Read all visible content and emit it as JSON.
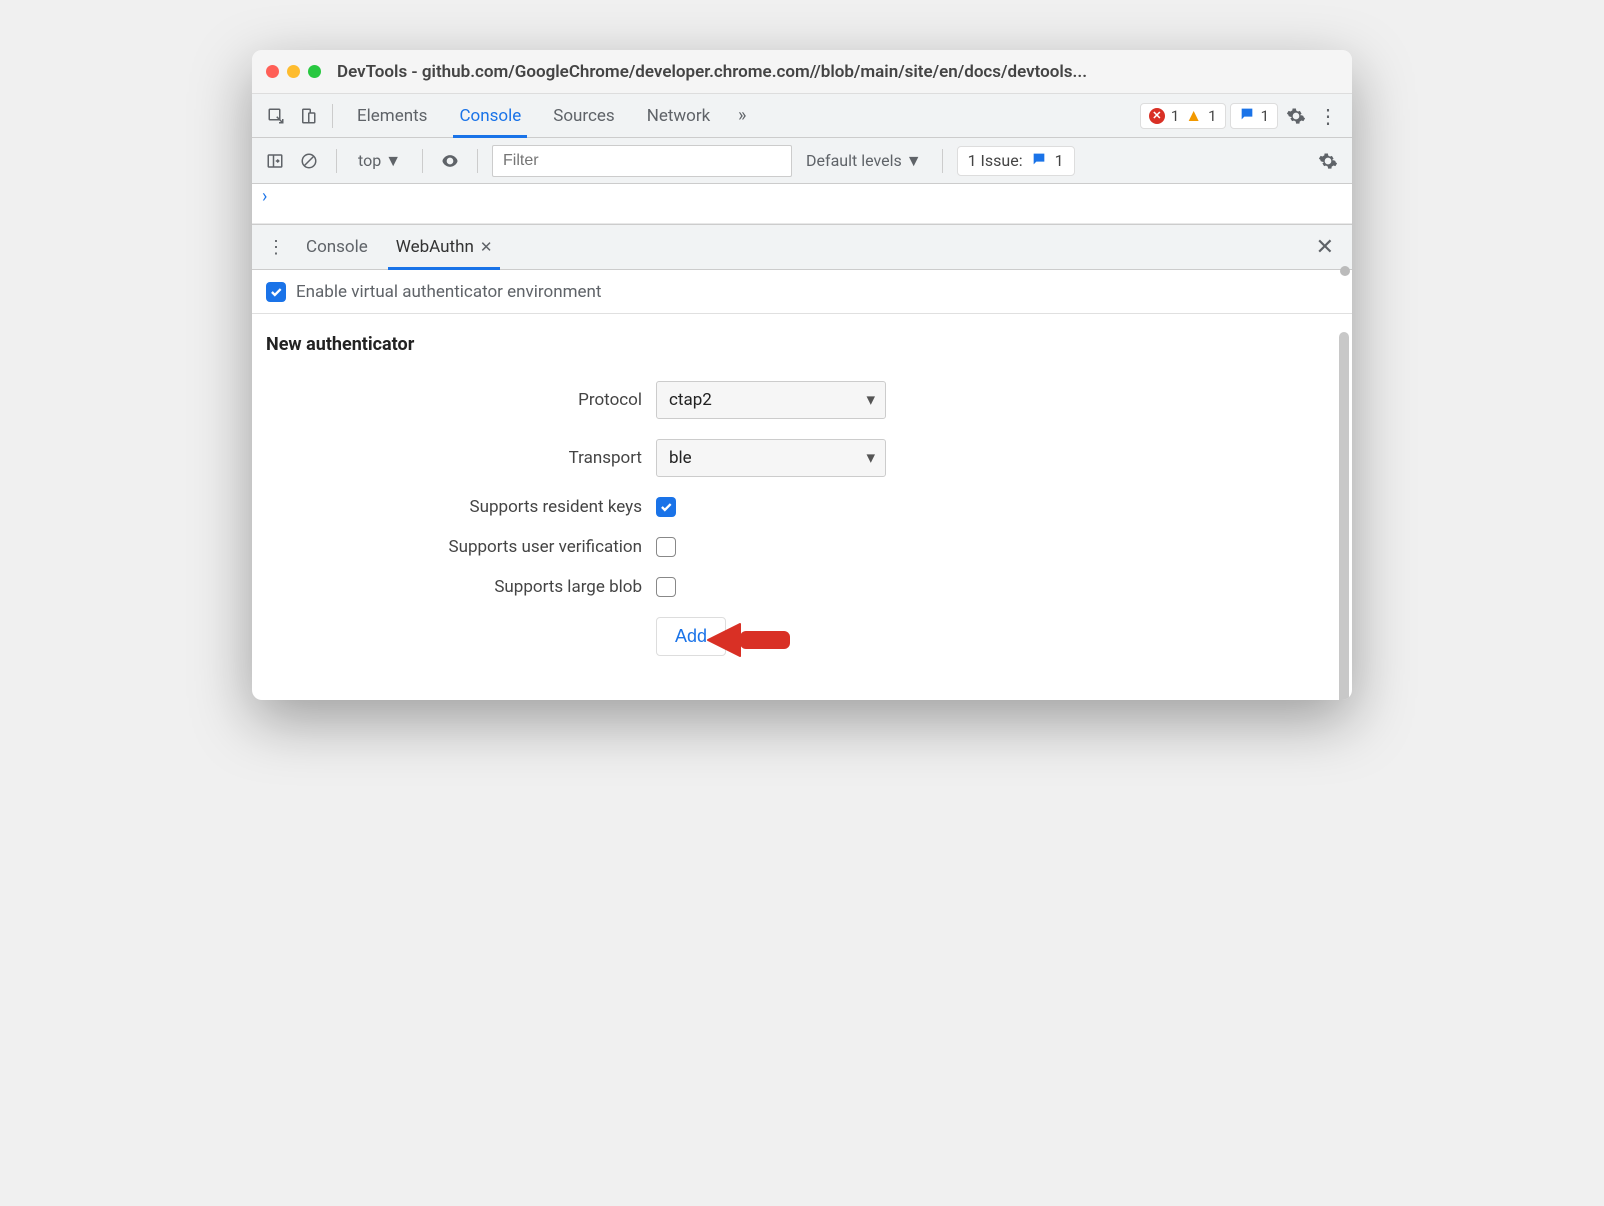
{
  "window": {
    "title": "DevTools - github.com/GoogleChrome/developer.chrome.com//blob/main/site/en/docs/devtools..."
  },
  "mainTabs": {
    "elements": "Elements",
    "console": "Console",
    "sources": "Sources",
    "network": "Network"
  },
  "badges": {
    "errors": "1",
    "warnings": "1",
    "messages": "1"
  },
  "consoleBar": {
    "context": "top",
    "filterPlaceholder": "Filter",
    "levels": "Default levels",
    "issuesLabel": "1 Issue:",
    "issuesCount": "1"
  },
  "drawer": {
    "consoleTab": "Console",
    "webauthnTab": "WebAuthn"
  },
  "enable": {
    "label": "Enable virtual authenticator environment"
  },
  "form": {
    "title": "New authenticator",
    "protocolLabel": "Protocol",
    "protocolValue": "ctap2",
    "transportLabel": "Transport",
    "transportValue": "ble",
    "residentKeysLabel": "Supports resident keys",
    "userVerificationLabel": "Supports user verification",
    "largeBlobLabel": "Supports large blob",
    "addButton": "Add"
  }
}
